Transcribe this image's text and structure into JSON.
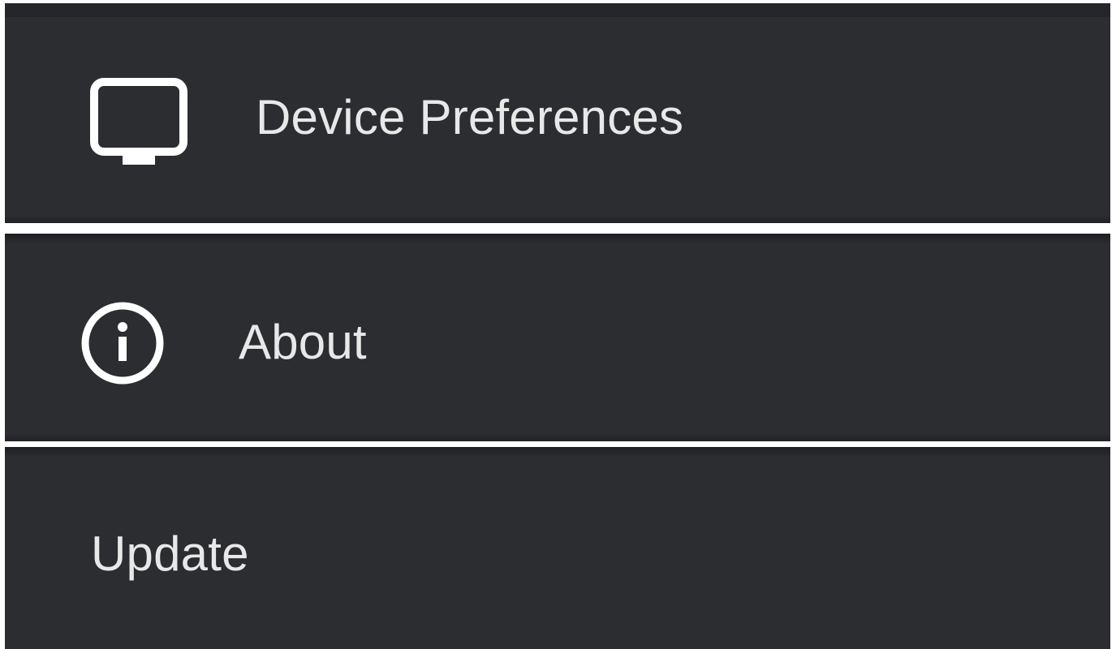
{
  "settings_menu": {
    "items": [
      {
        "label": "Device Preferences",
        "icon": "tv-icon"
      },
      {
        "label": "About",
        "icon": "info-icon"
      },
      {
        "label": "Update",
        "icon": null
      }
    ]
  },
  "colors": {
    "panel_background": "#2c2d31",
    "panel_top_strip": "#25262a",
    "separator": "#ffffff",
    "text": "#e8e8e8",
    "icon": "#ffffff"
  }
}
